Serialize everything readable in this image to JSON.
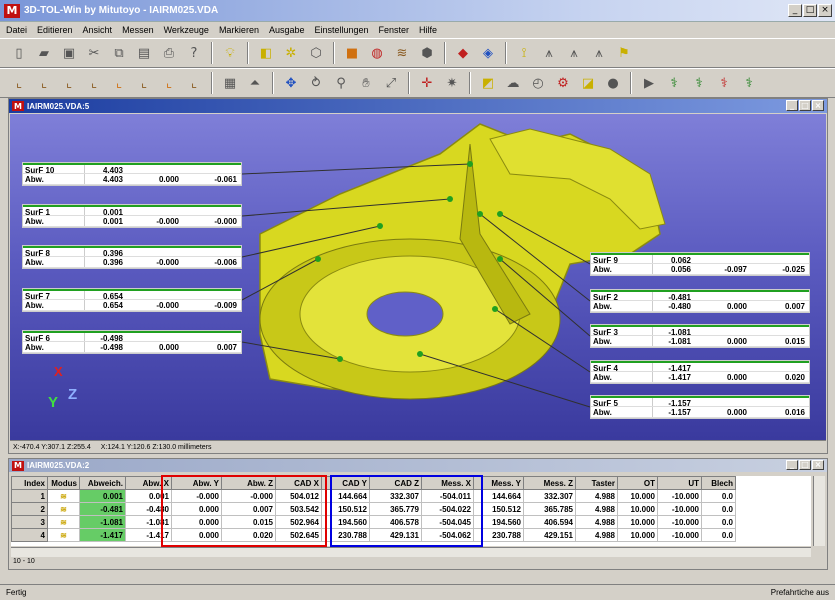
{
  "window": {
    "title": "3D-TOL-Win by Mitutoyo - IAIRM025.VDA",
    "logo": "M",
    "controls": [
      "_",
      "□",
      "×"
    ]
  },
  "menu": [
    "Datei",
    "Editieren",
    "Ansicht",
    "Messen",
    "Werkzeuge",
    "Markieren",
    "Ausgabe",
    "Einstellungen",
    "Fenster",
    "Hilfe"
  ],
  "toolbar1": [
    "new-icon",
    "open-icon",
    "save-icon",
    "cut-icon",
    "copy-icon",
    "paste-icon",
    "print-icon",
    "help-icon",
    "lightbulb-icon",
    "shade-icon",
    "wire-icon",
    "hidden-icon",
    "solid-icon",
    "sphere-icon",
    "surface-icon",
    "box-icon",
    "color-cube-icon",
    "cube-icon",
    "probe-icon",
    "probe-icon",
    "probe-icon",
    "probe-icon",
    "flag-icon"
  ],
  "view": {
    "title": "IAIRM025.VDA:5",
    "status_left": "X:-470.4 Y:307.1 Z:255.4",
    "status_right": "X:124.1 Y:120.6 Z:130.0 millimeters",
    "axes": {
      "x": "X",
      "y": "Y",
      "z": "Z"
    },
    "labels": [
      {
        "name": "SurF 10",
        "val": "4.403",
        "abw": "4.403",
        "dy": "0.000",
        "dz": "-0.061"
      },
      {
        "name": "SurF 1",
        "val": "0.001",
        "abw": "0.001",
        "dy": "-0.000",
        "dz": "-0.000"
      },
      {
        "name": "SurF 8",
        "val": "0.396",
        "abw": "0.396",
        "dy": "-0.000",
        "dz": "-0.006"
      },
      {
        "name": "SurF 7",
        "val": "0.654",
        "abw": "0.654",
        "dy": "-0.000",
        "dz": "-0.009"
      },
      {
        "name": "SurF 6",
        "val": "-0.498",
        "abw": "-0.498",
        "dy": "0.000",
        "dz": "0.007"
      },
      {
        "name": "SurF 9",
        "val": "0.062",
        "abw": "0.056",
        "dy": "-0.097",
        "dz": "-0.025"
      },
      {
        "name": "SurF 2",
        "val": "-0.481",
        "abw": "-0.480",
        "dy": "0.000",
        "dz": "0.007"
      },
      {
        "name": "SurF 3",
        "val": "-1.081",
        "abw": "-1.081",
        "dy": "0.000",
        "dz": "0.015"
      },
      {
        "name": "SurF 4",
        "val": "-1.417",
        "abw": "-1.417",
        "dy": "0.000",
        "dz": "0.020"
      },
      {
        "name": "SurF 5",
        "val": "-1.157",
        "abw": "-1.157",
        "dy": "0.000",
        "dz": "0.016"
      }
    ],
    "abw_label": "Abw."
  },
  "table": {
    "title": "IAIRM025.VDA:2",
    "columns": [
      "Index",
      "Modus",
      "Abweich.",
      "Abw. X",
      "Abw. Y",
      "Abw. Z",
      "CAD X",
      "CAD Y",
      "CAD Z",
      "Mess. X",
      "Mess. Y",
      "Mess. Z",
      "Taster",
      "OT",
      "UT",
      "Blech"
    ],
    "rows": [
      [
        "1",
        "≋",
        "0.001",
        "0.001",
        "-0.000",
        "-0.000",
        "504.012",
        "144.664",
        "332.307",
        "-504.011",
        "144.664",
        "332.307",
        "4.988",
        "10.000",
        "-10.000",
        "0.0"
      ],
      [
        "2",
        "≋",
        "-0.481",
        "-0.480",
        "0.000",
        "0.007",
        "503.542",
        "150.512",
        "365.779",
        "-504.022",
        "150.512",
        "365.785",
        "4.988",
        "10.000",
        "-10.000",
        "0.0"
      ],
      [
        "3",
        "≋",
        "-1.081",
        "-1.081",
        "0.000",
        "0.015",
        "502.964",
        "194.560",
        "406.578",
        "-504.045",
        "194.560",
        "406.594",
        "4.988",
        "10.000",
        "-10.000",
        "0.0"
      ],
      [
        "4",
        "≋",
        "-1.417",
        "-1.417",
        "0.000",
        "0.020",
        "502.645",
        "230.788",
        "429.131",
        "-504.062",
        "230.788",
        "429.151",
        "4.988",
        "10.000",
        "-10.000",
        "0.0"
      ]
    ],
    "status": "10 - 10"
  },
  "statusbar": {
    "left": "Fertig",
    "right": "Prefahrtiche aus"
  }
}
